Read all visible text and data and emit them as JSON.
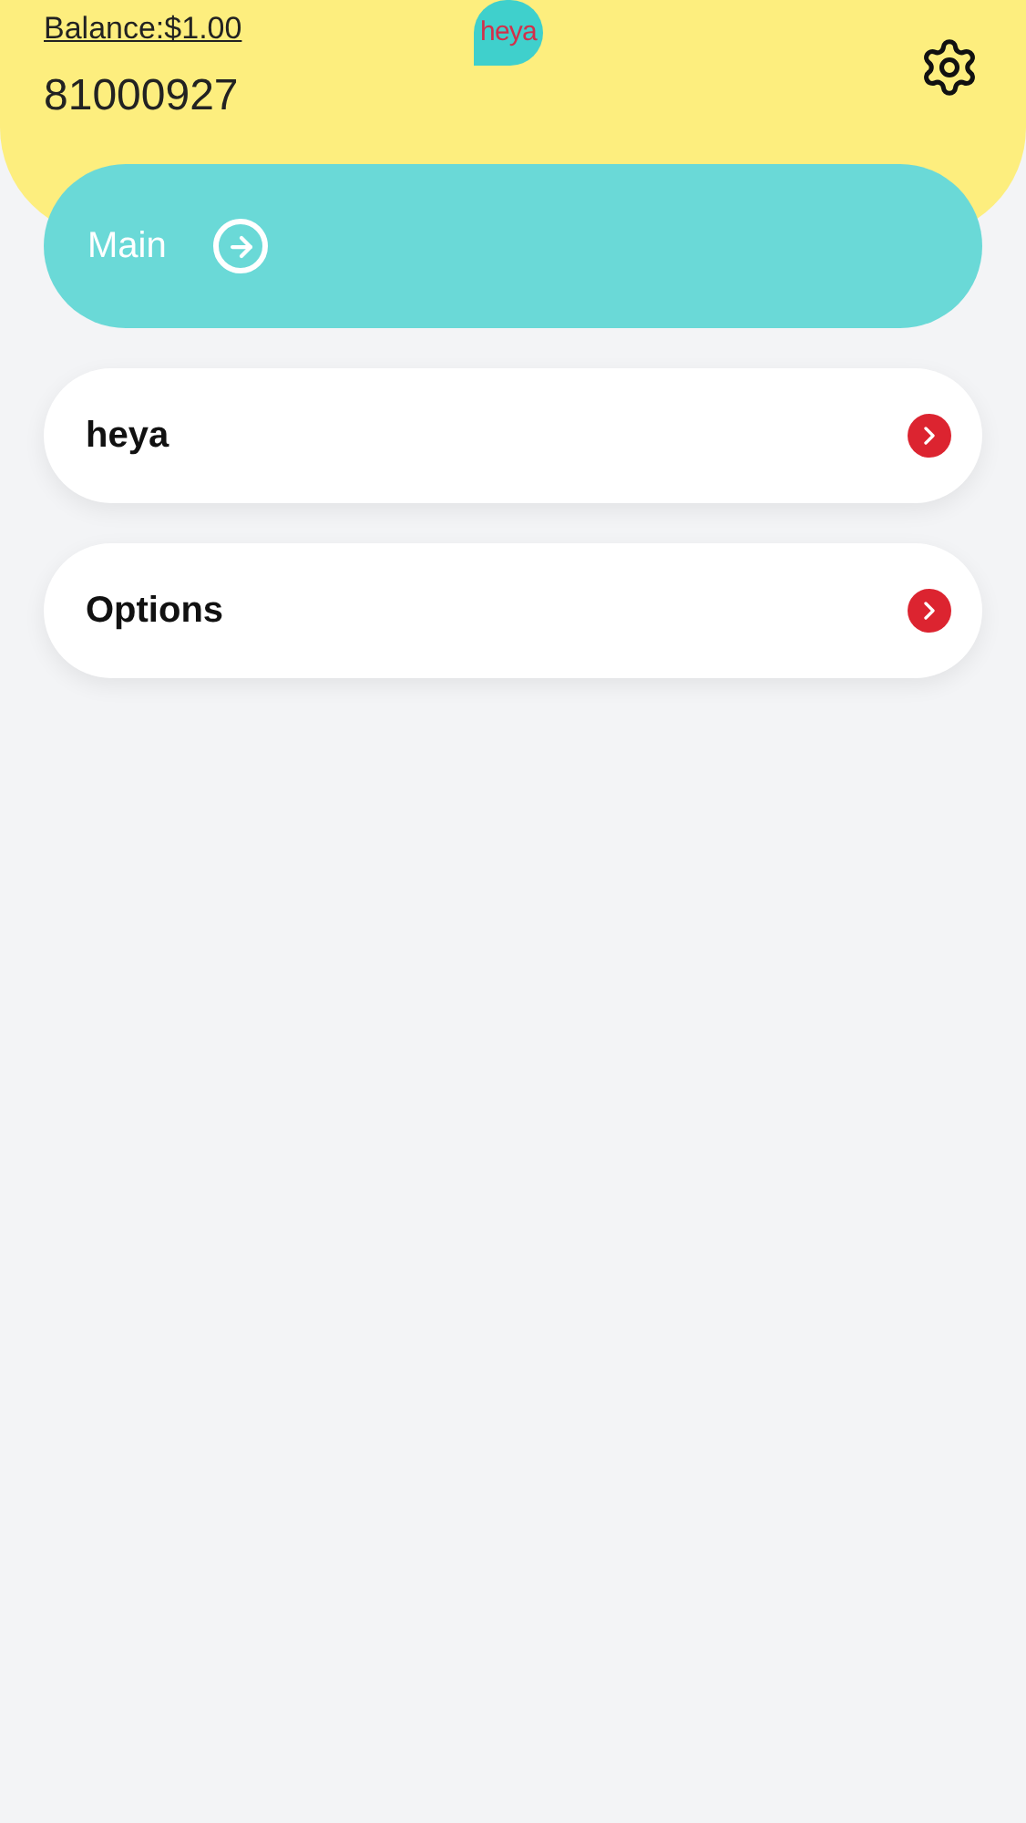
{
  "header": {
    "balance": "Balance:$1.00",
    "number": "81000927",
    "logo": "heya"
  },
  "main_button": {
    "label": "Main"
  },
  "menu": [
    {
      "label": "heya"
    },
    {
      "label": "Options"
    }
  ]
}
